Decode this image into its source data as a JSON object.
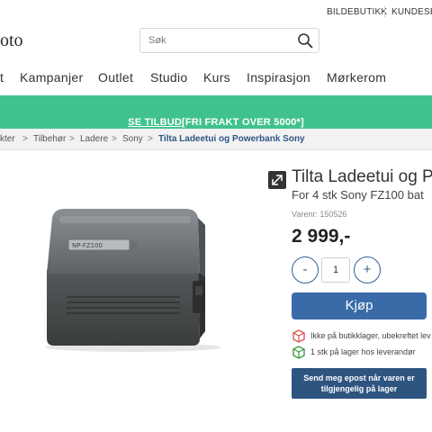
{
  "topbar": {
    "links": [
      "BILDEBUTIKK",
      "KUNDESEN"
    ]
  },
  "header": {
    "logo_text": "oto",
    "search": {
      "placeholder": "Søk",
      "icon": "search-icon"
    }
  },
  "nav": {
    "items": [
      "t",
      "Kampanjer",
      "Outlet",
      "Studio",
      "Kurs",
      "Inspirasjon",
      "Mørkerom"
    ]
  },
  "promo": {
    "link_text": "SE TILBUD",
    "text": " [FRI FRAKT OVER 5000*]",
    "color": "#40c28c"
  },
  "breadcrumb": {
    "items": [
      "kter",
      "Tilbehør",
      "Ladere",
      "Sony",
      "Tilta Ladeetui og Powerbank Sony"
    ],
    "separator": ">"
  },
  "product": {
    "image_label": "NP-FZ100",
    "title": "Tilta Ladeetui og P",
    "subtitle": "For 4 stk Sony FZ100 bat",
    "sku_label": "Varenr:",
    "sku": "150526",
    "price": "2 999,-",
    "quantity": "1",
    "minus_label": "-",
    "plus_label": "+",
    "buy_label": "Kjøp",
    "buy_color": "#3a6ba8",
    "stock": [
      {
        "icon": "store-box-icon",
        "text": "Ikke på butikklager, ubekreftet lev",
        "color": "#d9534f"
      },
      {
        "icon": "supplier-box-icon",
        "text": "1 stk på lager hos leverandør",
        "color": "#3a9a3a"
      }
    ],
    "notify_line1": "Send meg epost når varen er",
    "notify_line2": "tilgjengelig på lager"
  }
}
